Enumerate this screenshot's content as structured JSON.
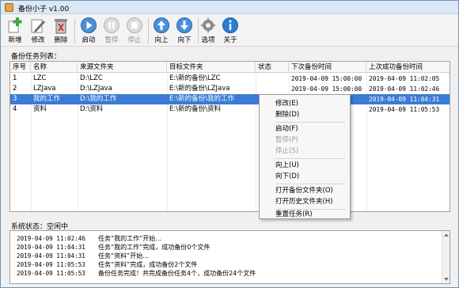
{
  "window": {
    "title": "备份小子 v1.00"
  },
  "toolbar": {
    "new": "新增",
    "edit": "修改",
    "delete": "删除",
    "start": "启动",
    "pause": "暂停",
    "stop": "停止",
    "up": "向上",
    "down": "向下",
    "options": "选项",
    "about": "关于"
  },
  "task_list": {
    "label": "备份任务列表：",
    "columns": [
      "序号",
      "名称",
      "来源文件夹",
      "目标文件夹",
      "状态",
      "下次备份时间",
      "上次成功备份时间"
    ],
    "rows": [
      {
        "num": "1",
        "name": "LZC",
        "source": "D:\\LZC",
        "target": "E:\\新的备份\\LZC",
        "status": "",
        "next": "2019-04-09 15:00:00",
        "last": "2019-04-09 11:02:05",
        "selected": false
      },
      {
        "num": "2",
        "name": "LZJava",
        "source": "D:\\LZJava",
        "target": "E:\\新的备份\\LZJava",
        "status": "",
        "next": "2019-04-09 15:00:00",
        "last": "2019-04-09 11:02:46",
        "selected": false
      },
      {
        "num": "3",
        "name": "我的工作",
        "source": "D:\\我的工作",
        "target": "E:\\新的备份\\我的工作",
        "status": "",
        "next": "",
        "last": "2019-04-09 11:04:31",
        "selected": true
      },
      {
        "num": "4",
        "name": "资料",
        "source": "D:\\资料",
        "target": "E:\\新的备份\\资料",
        "status": "",
        "next": "",
        "last": "2019-04-09 11:05:53",
        "selected": false
      }
    ]
  },
  "status": {
    "label": "系统状态：空闲中"
  },
  "log": [
    {
      "time": "2019-04-09 11:02:46",
      "message": "任务“我的工作”开始..."
    },
    {
      "time": "2019-04-09 11:04:31",
      "message": "任务“我的工作”完成，成功备份0个文件"
    },
    {
      "time": "2019-04-09 11:04:31",
      "message": "任务“资料”开始..."
    },
    {
      "time": "2019-04-09 11:05:53",
      "message": "任务“资料”完成，成功备份2个文件"
    },
    {
      "time": "2019-04-09 11:05:53",
      "message": "备份任务完成！共完成备份任务4个，成功备份24个文件"
    }
  ],
  "context_menu": {
    "edit": "修改(E)",
    "delete": "删除(D)",
    "start": "启动(F)",
    "pause": "暂停(P)",
    "stop": "停止(S)",
    "up": "向上(U)",
    "down": "向下(D)",
    "open_backup": "打开备份文件夹(O)",
    "open_history": "打开历史文件夹(H)",
    "reset": "重置任务(R)"
  },
  "colors": {
    "selection": "#3a7bd5",
    "accent_blue": "#2a7fd4",
    "green": "#3aa93a"
  },
  "icons": {
    "new": "plus-icon",
    "edit": "pencil-icon",
    "delete": "trash-icon",
    "start": "play-icon",
    "pause": "pause-icon",
    "stop": "stop-icon",
    "up": "arrow-up-icon",
    "down": "arrow-down-icon",
    "options": "gear-icon",
    "about": "info-icon"
  }
}
